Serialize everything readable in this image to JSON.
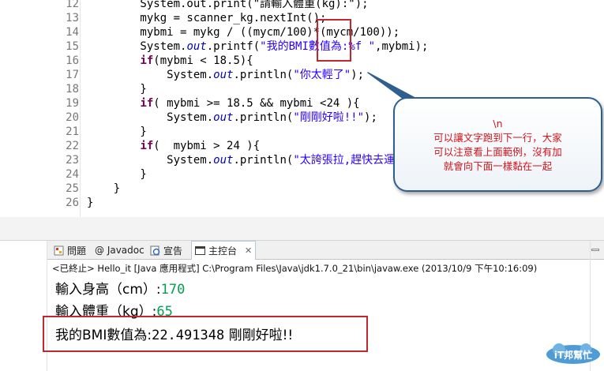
{
  "editor": {
    "lines": [
      {
        "num": "12",
        "segments": [
          {
            "t": "        System.out.print(\"請輸入體重(kg):\");",
            "c": "plain"
          }
        ]
      },
      {
        "num": "13",
        "segments": [
          {
            "t": "        mykg = scanner_kg.nextInt();",
            "c": "plain"
          }
        ]
      },
      {
        "num": "14",
        "segments": [
          {
            "t": "        mybmi = mykg / ((mycm/100)*(mycm/100));",
            "c": "plain"
          }
        ]
      },
      {
        "num": "15",
        "segments": [
          {
            "t": "        System.",
            "c": "plain"
          },
          {
            "t": "out",
            "c": "fld"
          },
          {
            "t": ".printf(",
            "c": "plain"
          },
          {
            "t": "\"我的BMI數值為:%f \"",
            "c": "str"
          },
          {
            "t": ",mybmi);",
            "c": "plain"
          }
        ]
      },
      {
        "num": "16",
        "segments": [
          {
            "t": "        ",
            "c": "plain"
          },
          {
            "t": "if",
            "c": "kw"
          },
          {
            "t": "(mybmi < 18.5){",
            "c": "plain"
          }
        ]
      },
      {
        "num": "17",
        "segments": [
          {
            "t": "            System.",
            "c": "plain"
          },
          {
            "t": "out",
            "c": "fld"
          },
          {
            "t": ".println(",
            "c": "plain"
          },
          {
            "t": "\"你太輕了\"",
            "c": "str"
          },
          {
            "t": ");",
            "c": "plain"
          }
        ]
      },
      {
        "num": "18",
        "segments": [
          {
            "t": "        }",
            "c": "plain"
          }
        ]
      },
      {
        "num": "19",
        "segments": [
          {
            "t": "        ",
            "c": "plain"
          },
          {
            "t": "if",
            "c": "kw"
          },
          {
            "t": "( mybmi >= 18.5 && mybmi <24 ){",
            "c": "plain"
          }
        ]
      },
      {
        "num": "20",
        "segments": [
          {
            "t": "            System.",
            "c": "plain"
          },
          {
            "t": "out",
            "c": "fld"
          },
          {
            "t": ".println(",
            "c": "plain"
          },
          {
            "t": "\"剛剛好啦!!\"",
            "c": "str"
          },
          {
            "t": ");",
            "c": "plain"
          }
        ]
      },
      {
        "num": "21",
        "segments": [
          {
            "t": "        }",
            "c": "plain"
          }
        ]
      },
      {
        "num": "22",
        "segments": [
          {
            "t": "        ",
            "c": "plain"
          },
          {
            "t": "if",
            "c": "kw"
          },
          {
            "t": "(  mybmi > 24 ){",
            "c": "plain"
          }
        ]
      },
      {
        "num": "23",
        "segments": [
          {
            "t": "            System.",
            "c": "plain"
          },
          {
            "t": "out",
            "c": "fld"
          },
          {
            "t": ".println(",
            "c": "plain"
          },
          {
            "t": "\"太誇張拉,趕快去運動!!\"",
            "c": "str"
          },
          {
            "t": ");",
            "c": "plain"
          }
        ]
      },
      {
        "num": "24",
        "segments": [
          {
            "t": "        }",
            "c": "plain"
          }
        ]
      },
      {
        "num": "25",
        "segments": [
          {
            "t": "    }",
            "c": "plain"
          }
        ]
      },
      {
        "num": "26",
        "segments": [
          {
            "t": "}",
            "c": "plain"
          }
        ]
      }
    ]
  },
  "callout": {
    "lines": [
      "\\n",
      "可以讓文字跑到下一行，大家",
      "可以注意看上面範例，沒有加",
      "就會向下面一樣黏在一起"
    ],
    "color": "#d0141b"
  },
  "console": {
    "tabs": [
      {
        "label": "問題",
        "icon": "problems-icon"
      },
      {
        "label": "@ Javadoc",
        "icon": "javadoc-icon"
      },
      {
        "label": "宣告",
        "icon": "declaration-icon"
      },
      {
        "label": "主控台",
        "icon": "console-icon"
      }
    ],
    "close_symbol": "✕",
    "header": "<已終止> Hello_it [Java 應用程式] C:\\Program Files\\Java\\jdk1.7.0_21\\bin\\javaw.exe (2013/10/9 下午10:16:09)",
    "height_prompt": "輸入身高（cm）:",
    "height_value": "170",
    "weight_prompt": "輸入體重（kg）:",
    "weight_value": "65",
    "result_label": "我的BMI數值為:",
    "result_value": "22.491348",
    "result_message": "剛剛好啦!!",
    "input_color": "#00a050"
  },
  "colors": {
    "keyword": "#7f0055",
    "field": "#0000c0",
    "string": "#2a00ff",
    "highlight_border": "#c0282f",
    "callout_border": "#2e5f8f"
  },
  "watermark": {
    "text": "iT邦幫忙",
    "icon": "ithelp-logo"
  }
}
